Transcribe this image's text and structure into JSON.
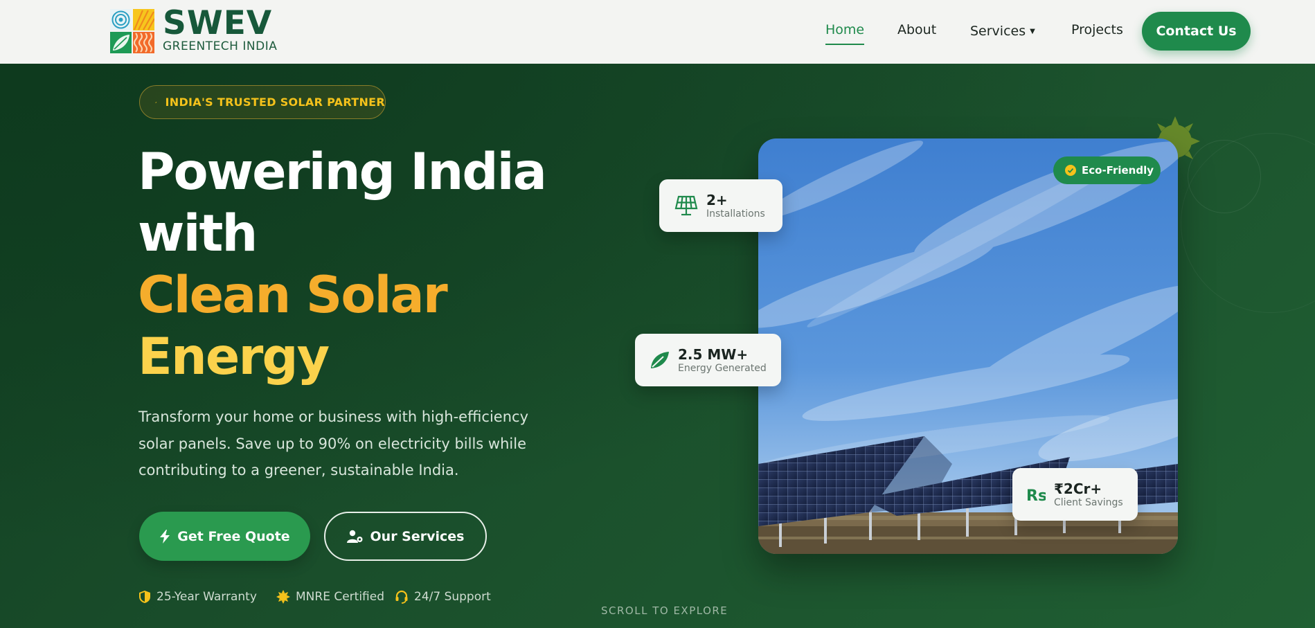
{
  "brand": {
    "name": "SWEV",
    "tagline": "GREENTECH INDIA"
  },
  "nav": {
    "items": [
      {
        "label": "Home",
        "active": true
      },
      {
        "label": "About"
      },
      {
        "label": "Services",
        "has_dropdown": true
      },
      {
        "label": "Projects"
      }
    ],
    "cta": "Contact Us"
  },
  "hero": {
    "badge": "INDIA'S TRUSTED SOLAR PARTNER",
    "headline": {
      "line1": "Powering India",
      "line2": "with",
      "line3": "Clean Solar",
      "line4": "Energy"
    },
    "description": "Transform your home or business with high-efficiency solar panels. Save up to 90% on electricity bills while contributing to a greener, sustainable India.",
    "primary_button": "Get Free Quote",
    "secondary_button": "Our Services",
    "trust_items": [
      {
        "label": "25-Year Warranty",
        "icon": "shield-icon"
      },
      {
        "label": "MNRE Certified",
        "icon": "sun-badge-icon"
      },
      {
        "label": "24/7 Support",
        "icon": "headset-icon"
      }
    ],
    "scroll_hint": "SCROLL TO EXPLORE"
  },
  "visual": {
    "tag": "Eco-Friendly",
    "stats": [
      {
        "value": "2+",
        "label": "Installations",
        "icon": "solar-panel-icon"
      },
      {
        "value": "2.5 MW+",
        "label": "Energy Generated",
        "icon": "leaf-icon"
      },
      {
        "value": "₹2Cr+",
        "label": "Client Savings",
        "icon": "rupee-icon"
      }
    ]
  },
  "colors": {
    "brand_green": "#1f8a4c",
    "hero_bg": "#1b4d2a",
    "accent_yellow": "#f5c21b",
    "headline_orange": "#f5ad2c"
  }
}
